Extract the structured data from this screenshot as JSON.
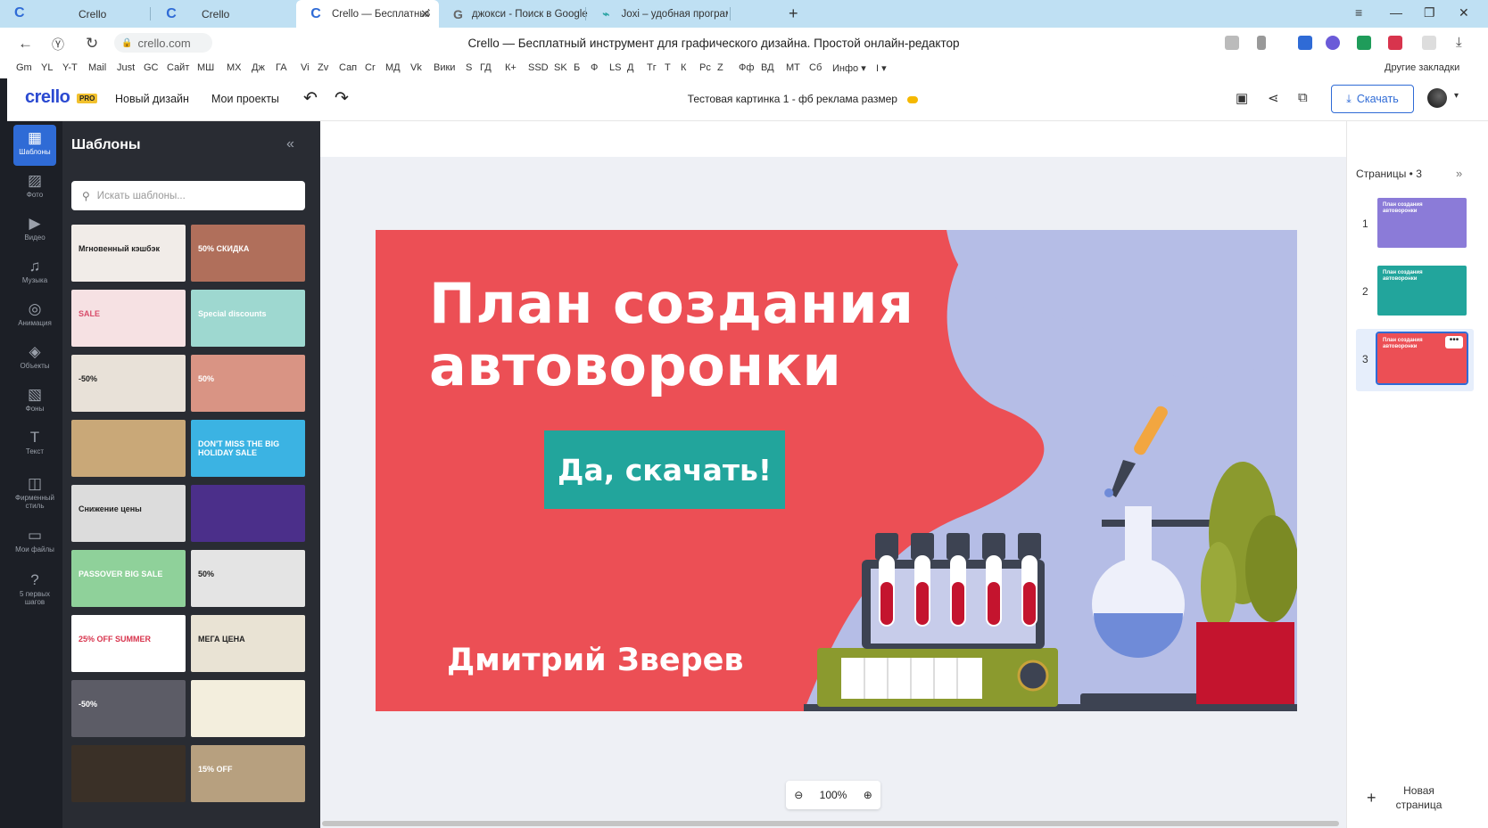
{
  "browser": {
    "tabs": [
      {
        "label": "Crello",
        "icon": "crello-icon",
        "active": false
      },
      {
        "label": "Crello",
        "icon": "crello-icon",
        "active": false
      },
      {
        "label": "Crello — Бесплатный и",
        "icon": "crello-icon",
        "active": true
      },
      {
        "label": "джокси - Поиск в Google",
        "icon": "google-icon",
        "active": false
      },
      {
        "label": "Joxi – удобная программа",
        "icon": "joxi-icon",
        "active": false
      }
    ],
    "url": "crello.com",
    "page_title": "Crello — Бесплатный инструмент для графического дизайна. Простой онлайн-редактор",
    "bookmarks": [
      "Gm",
      "YL",
      "Y-T",
      "Mail",
      "Just",
      "GC",
      "Сайт",
      "МШ",
      "МХ",
      "Дж",
      "ГА",
      "Vi",
      "Zv",
      "Сап",
      "Cr",
      "МД",
      "Vk",
      "Вики",
      "S",
      "ГД",
      "К+",
      "SSD",
      "SK",
      "Б",
      "Ф",
      "LS",
      "Д",
      "Тг",
      "Т",
      "К",
      "Рс",
      "Z",
      "Фф",
      "ВД",
      "МТ",
      "Сб",
      "Инфо ▾",
      "I ▾"
    ],
    "other_bookmarks": "Другие закладки"
  },
  "app": {
    "logo": "crello",
    "pro_badge": "PRO",
    "new_design": "Новый дизайн",
    "my_projects": "Мои проекты",
    "doc_title": "Тестовая картинка 1 - фб реклама размер",
    "download": "Скачать",
    "accent": "#2f6bd6"
  },
  "rail": [
    {
      "label": "Шаблоны",
      "icon": "templates-icon",
      "active": true
    },
    {
      "label": "Фото",
      "icon": "photo-icon"
    },
    {
      "label": "Видео",
      "icon": "video-icon"
    },
    {
      "label": "Музыка",
      "icon": "music-icon"
    },
    {
      "label": "Анимация",
      "icon": "animation-icon"
    },
    {
      "label": "Объекты",
      "icon": "objects-icon"
    },
    {
      "label": "Фоны",
      "icon": "backgrounds-icon"
    },
    {
      "label": "Текст",
      "icon": "text-icon"
    },
    {
      "label": "Фирменный стиль",
      "icon": "brand-icon"
    },
    {
      "label": "Мои файлы",
      "icon": "folder-icon"
    },
    {
      "label": "5 первых шагов",
      "icon": "help-icon"
    }
  ],
  "panel": {
    "title": "Шаблоны",
    "search_placeholder": "Искать шаблоны...",
    "thumbnails": [
      {
        "text": "Мгновенный кэшбэк",
        "bg": "#f1ece8",
        "fg": "#222"
      },
      {
        "text": "50% СКИДКА",
        "bg": "#b06f5b",
        "fg": "#fff"
      },
      {
        "text": "SALE",
        "bg": "#f6e1e3",
        "fg": "#d84d6b"
      },
      {
        "text": "Special discounts",
        "bg": "#9ed8d0",
        "fg": "#fff"
      },
      {
        "text": "-50%",
        "bg": "#e8e1d8",
        "fg": "#222"
      },
      {
        "text": "50%",
        "bg": "#d99484",
        "fg": "#fff"
      },
      {
        "text": "",
        "bg": "#c9a878",
        "fg": "#fff"
      },
      {
        "text": "DON'T MISS THE BIG HOLIDAY SALE",
        "bg": "#3bb3e3",
        "fg": "#fff"
      },
      {
        "text": "Снижение цены",
        "bg": "#dcdcdc",
        "fg": "#222"
      },
      {
        "text": "",
        "bg": "#4b2f8a",
        "fg": "#fff"
      },
      {
        "text": "PASSOVER BIG SALE",
        "bg": "#8fd19a",
        "fg": "#fff"
      },
      {
        "text": "50%",
        "bg": "#e4e4e4",
        "fg": "#222"
      },
      {
        "text": "25% OFF SUMMER",
        "bg": "#ffffff",
        "fg": "#d8344d"
      },
      {
        "text": "МЕГА ЦЕНА",
        "bg": "#e9e3d4",
        "fg": "#222"
      },
      {
        "text": "-50%",
        "bg": "#5c5c66",
        "fg": "#fff"
      },
      {
        "text": "",
        "bg": "#f3eedd",
        "fg": "#222"
      },
      {
        "text": "",
        "bg": "#3a3027",
        "fg": "#fff"
      },
      {
        "text": "15% OFF",
        "bg": "#b7a07f",
        "fg": "#fff"
      }
    ]
  },
  "design": {
    "headline_line1": "План создания",
    "headline_line2": "автоворонки",
    "cta": "Да, скачать!",
    "author": "Дмитрий Зверев",
    "bg_color": "#ec4f55",
    "cta_color": "#22a59c"
  },
  "zoom": "100%",
  "pages": {
    "title": "Страницы • 3",
    "items": [
      {
        "num": "1",
        "thumb_text": "План создания автоворонки",
        "bg": "#8b7bd8"
      },
      {
        "num": "2",
        "thumb_text": "План создания автоворонки",
        "bg": "#22a59c"
      },
      {
        "num": "3",
        "thumb_text": "План создания автоворонки",
        "bg": "#ec4f55",
        "active": true
      }
    ],
    "new_page": "Новая страница"
  }
}
